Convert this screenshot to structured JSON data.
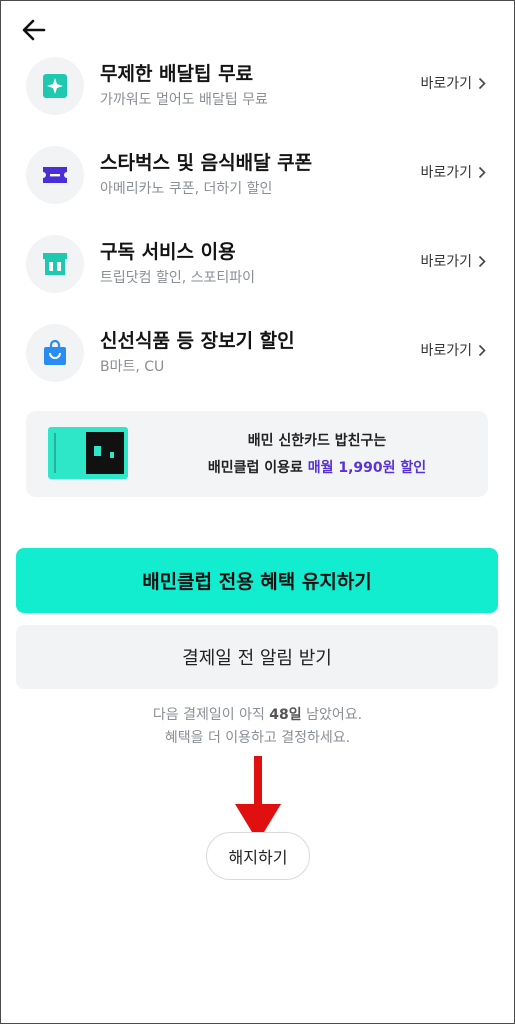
{
  "benefits": [
    {
      "title": "무제한 배달팁 무료",
      "subtitle": "가까워도 멀어도 배달팁 무료",
      "link": "바로가기",
      "icon": "sparkle-icon",
      "color": "#1ec9b0"
    },
    {
      "title": "스타벅스 및 음식배달 쿠폰",
      "subtitle": "아메리카노 쿠폰, 더하기 할인",
      "link": "바로가기",
      "icon": "ticket-icon",
      "color": "#4a2fd6"
    },
    {
      "title": "구독 서비스 이용",
      "subtitle": "트립닷컴 할인, 스포티파이",
      "link": "바로가기",
      "icon": "store-icon",
      "color": "#1ec9b0"
    },
    {
      "title": "신선식품 등 장보기 할인",
      "subtitle": "B마트, CU",
      "link": "바로가기",
      "icon": "shopping-bag-icon",
      "color": "#2a8cf0"
    }
  ],
  "banner": {
    "line1": "배민 신한카드 밥친구는",
    "line2_prefix": "배민클럽 이용료 ",
    "line2_highlight": "매월 1,990원 할인",
    "highlight_color": "#5a33d6"
  },
  "buttons": {
    "keep": "배민클럽 전용 혜택 유지하기",
    "notify": "결제일 전 알림 받기",
    "cancel": "해지하기"
  },
  "notice": {
    "prefix": "다음 결제일이 아직 ",
    "days": "48일",
    "suffix": " 남았어요.",
    "line2": "혜택을 더 이용하고 결정하세요."
  },
  "colors": {
    "accent": "#12eccf",
    "annotation_arrow": "#e01010"
  }
}
